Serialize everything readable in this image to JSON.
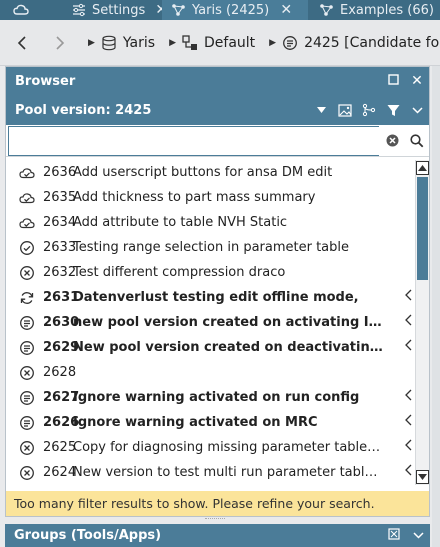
{
  "tabs": [
    {
      "name": "tab-cloud",
      "label": "",
      "icon": "cloud-icon"
    },
    {
      "name": "tab-settings",
      "label": "Settings",
      "icon": "sliders-icon"
    },
    {
      "name": "tab-yaris",
      "label": "Yaris (2425)",
      "icon": "graph-icon"
    },
    {
      "name": "tab-examples",
      "label": "Examples (66)",
      "icon": "graph-icon"
    }
  ],
  "breadcrumb": {
    "items": [
      {
        "label": "Yaris",
        "icon": "database-icon"
      },
      {
        "label": "Default",
        "icon": "branch-icon"
      },
      {
        "label": "2425 [Candidate fo",
        "icon": "pool-version-icon"
      }
    ]
  },
  "browser": {
    "title": "Browser",
    "pool_label": "Pool version: 2425",
    "search": {
      "value": "",
      "placeholder": ""
    },
    "items": [
      {
        "num": "2636",
        "title": "Add userscript buttons for ansa DM edit",
        "bold": false,
        "icon": "cloud-check-icon",
        "chevron": false
      },
      {
        "num": "2635",
        "title": "Add thickness to part mass summary",
        "bold": false,
        "icon": "cloud-check-icon",
        "chevron": false
      },
      {
        "num": "2634",
        "title": "Add attribute to table NVH Static",
        "bold": false,
        "icon": "cloud-check-icon",
        "chevron": false
      },
      {
        "num": "2633",
        "title": "Testing range selection in parameter table",
        "bold": false,
        "icon": "check-circle-icon",
        "chevron": false
      },
      {
        "num": "2632",
        "title": "Test different compression draco",
        "bold": false,
        "icon": "x-circle-icon",
        "chevron": false
      },
      {
        "num": "2631",
        "title": "Datenverlust testing edit offline mode,",
        "bold": true,
        "icon": "sync-icon",
        "chevron": true
      },
      {
        "num": "2630",
        "title": "new pool version created on activating Ignore w.",
        "bold": true,
        "icon": "pool-version-icon",
        "chevron": true
      },
      {
        "num": "2629",
        "title": "New pool version created on deactivating Ignore",
        "bold": true,
        "icon": "pool-version-icon",
        "chevron": true
      },
      {
        "num": "2628",
        "title": "",
        "bold": false,
        "icon": "x-circle-icon",
        "chevron": false
      },
      {
        "num": "2627",
        "title": "Ignore warning activated on run config",
        "bold": true,
        "icon": "pool-version-icon",
        "chevron": true
      },
      {
        "num": "2626",
        "title": "Ignore warning activated on MRC",
        "bold": true,
        "icon": "pool-version-icon",
        "chevron": true
      },
      {
        "num": "2625",
        "title": "Copy for diagnosing missing parameter tables in...",
        "bold": false,
        "icon": "x-circle-icon",
        "chevron": true
      },
      {
        "num": "2624",
        "title": "New version to test multi run parameter table co...",
        "bold": false,
        "icon": "x-circle-icon",
        "chevron": true
      }
    ],
    "warning": "Too many filter results to show. Please refine your search."
  },
  "groups": {
    "title": "Groups (Tools/Apps)"
  },
  "colors": {
    "accent": "#4b7c98",
    "tabbar": "#3d6b84",
    "warning_bg": "#fbe49a"
  }
}
